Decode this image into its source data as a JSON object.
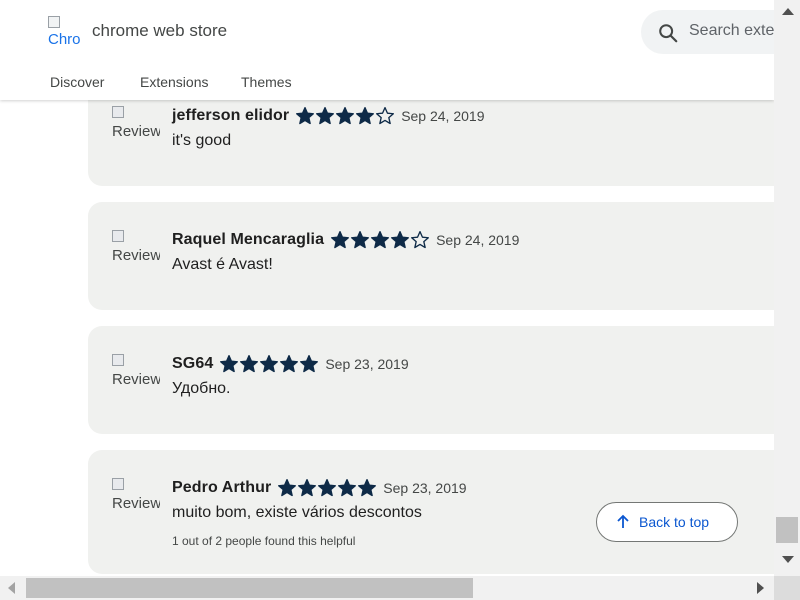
{
  "header": {
    "logo_alt": "Chrome",
    "title": "chrome web store",
    "search_placeholder": "Search extensions and themes",
    "search_icon": "search-icon"
  },
  "nav": {
    "tabs": [
      {
        "label": "Discover"
      },
      {
        "label": "Extensions"
      },
      {
        "label": "Themes"
      }
    ]
  },
  "reviews": [
    {
      "avatar_alt": "Reviewer",
      "author": "jefferson elidor",
      "rating": 4,
      "date": "Sep 24, 2019",
      "text": "it's good",
      "helpful": ""
    },
    {
      "avatar_alt": "Reviewer",
      "author": "Raquel Mencaraglia",
      "rating": 4,
      "date": "Sep 24, 2019",
      "text": "Avast é Avast!",
      "helpful": ""
    },
    {
      "avatar_alt": "Reviewer",
      "author": "SG64",
      "rating": 5,
      "date": "Sep 23, 2019",
      "text": "Удобно.",
      "helpful": ""
    },
    {
      "avatar_alt": "Reviewer",
      "author": "Pedro Arthur",
      "rating": 5,
      "date": "Sep 23, 2019",
      "text": "muito bom, existe vários descontos",
      "helpful": "1 out of 2 people found this helpful"
    }
  ],
  "back_to_top": {
    "label": "Back to top",
    "icon": "arrow-up-icon"
  },
  "colors": {
    "star": "#0e2a47",
    "link": "#0b57d0",
    "card": "#f0f1ef"
  }
}
